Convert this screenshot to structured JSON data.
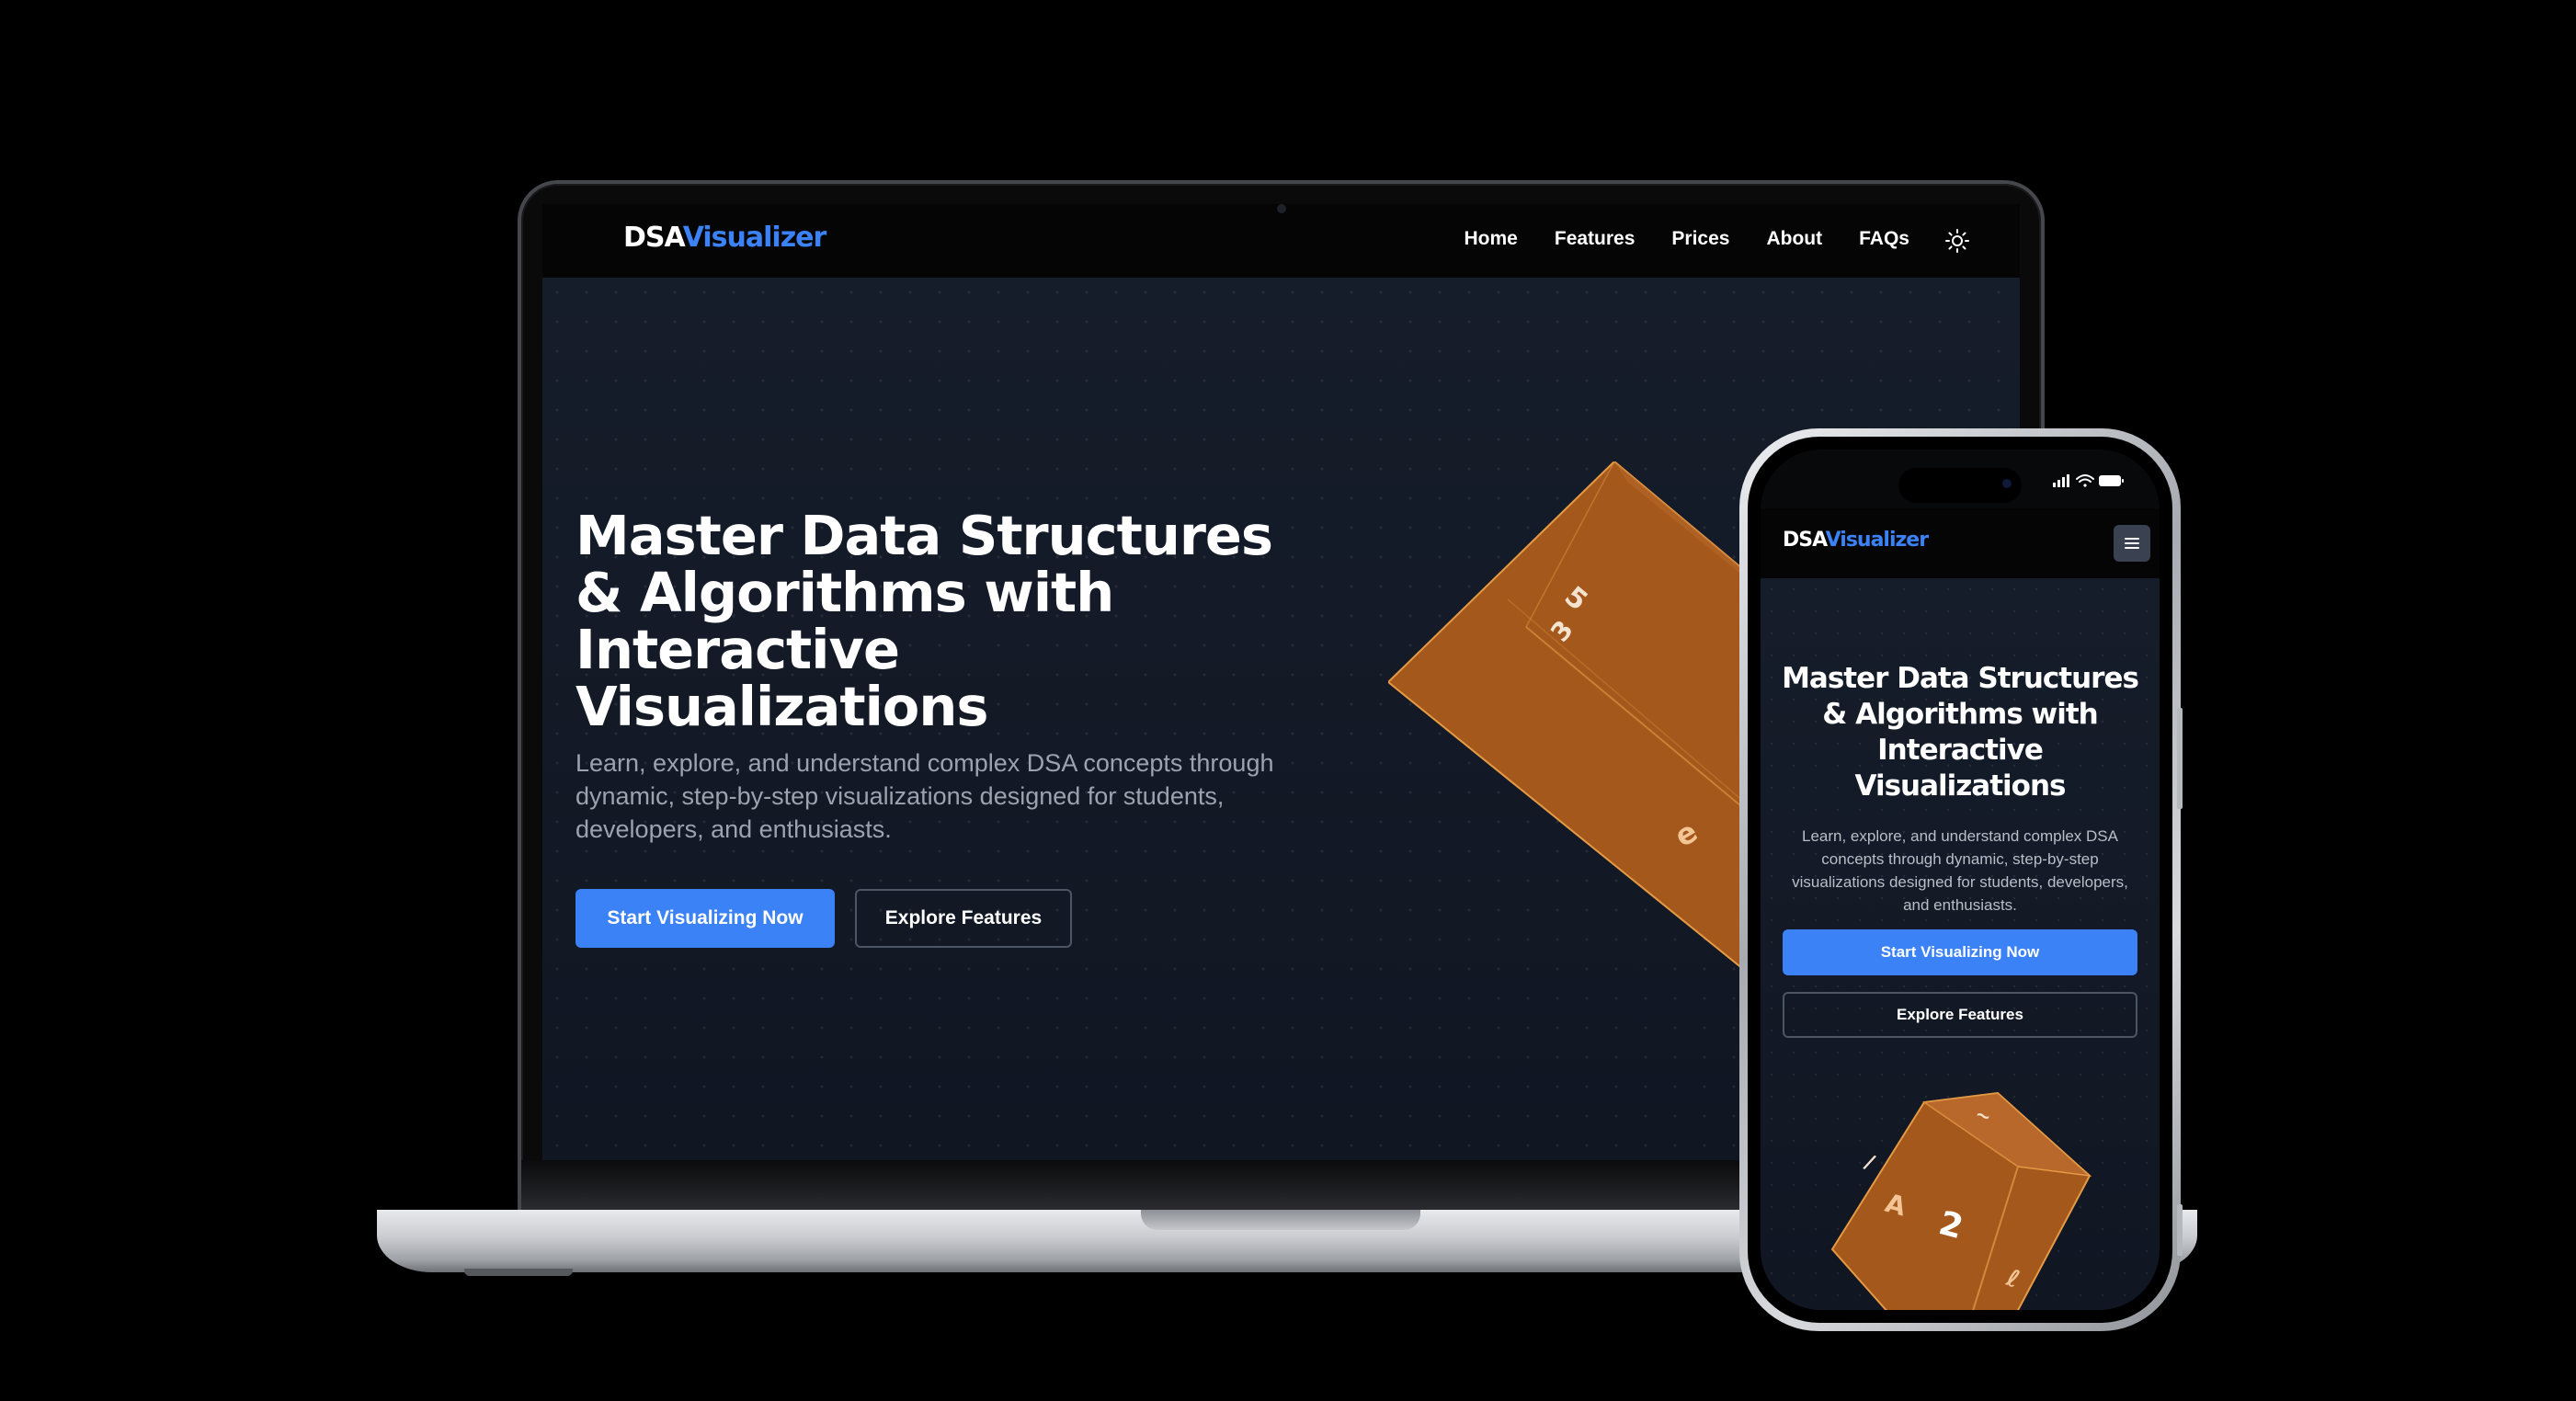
{
  "brand": {
    "part1": "DSA",
    "part2": "Visualizer"
  },
  "nav": {
    "links": [
      "Home",
      "Features",
      "Prices",
      "About",
      "FAQs"
    ],
    "theme_toggle_icon": "sun-icon",
    "mobile_menu_icon": "hamburger-menu-icon"
  },
  "hero": {
    "title": "Master Data Structures & Algorithms with Interactive Visualizations",
    "subtitle": "Learn, explore, and understand complex DSA concepts through dynamic, step-by-step visualizations designed for students, developers, and enthusiasts.",
    "primary_button": "Start Visualizing Now",
    "secondary_button": "Explore Features"
  },
  "cube": {
    "laptop_glyphs": [
      "5",
      "3",
      "e"
    ],
    "phone_glyphs": [
      "A",
      "2",
      "ℓ",
      "/",
      "~"
    ]
  },
  "colors": {
    "accent": "#3b82f6",
    "background": "#141a26",
    "cube": "#a4581b"
  }
}
